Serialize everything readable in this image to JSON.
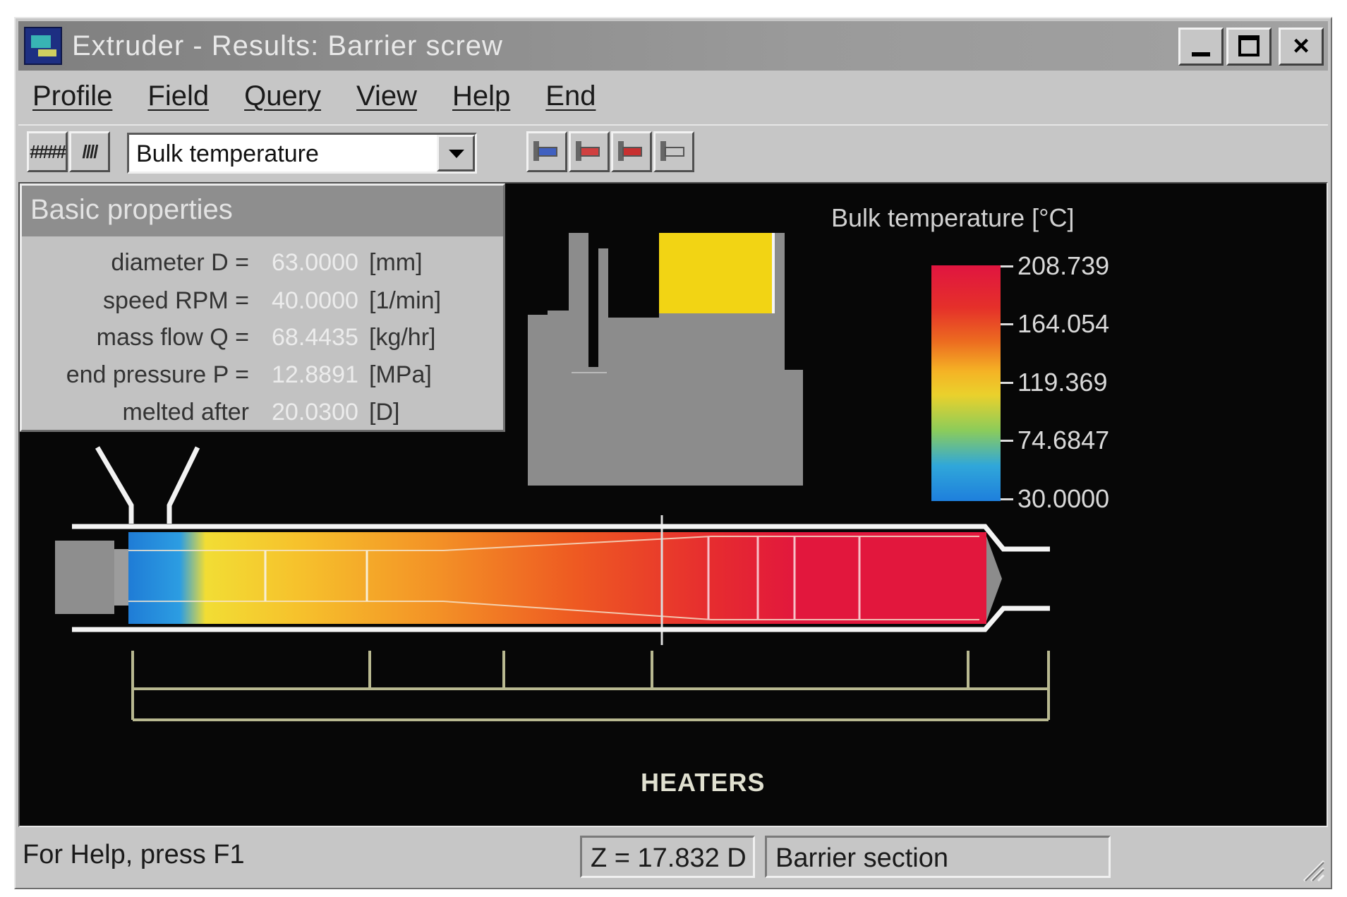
{
  "window": {
    "title": "Extruder - Results: Barrier screw",
    "controls": {
      "minimize": "_",
      "maximize": "□",
      "close": "×"
    }
  },
  "menu": [
    {
      "label": "Profile"
    },
    {
      "label": "Field"
    },
    {
      "label": "Query"
    },
    {
      "label": "View"
    },
    {
      "label": "Help"
    },
    {
      "label": "End"
    }
  ],
  "toolbar": {
    "grid_buttons": [
      {
        "icon": "grid-icon",
        "glyph": "####"
      },
      {
        "icon": "grid-skew-icon",
        "glyph": "////"
      }
    ],
    "field_select": {
      "value": "Bulk temperature"
    },
    "tool_buttons": [
      {
        "icon": "screw-section-icon"
      },
      {
        "icon": "screw-profile-icon"
      },
      {
        "icon": "screw-fill-icon"
      },
      {
        "icon": "screw-arrow-icon"
      }
    ]
  },
  "properties": {
    "title": "Basic properties",
    "rows": [
      {
        "label": "diameter  D =",
        "value": "63.0000",
        "unit": "[mm]"
      },
      {
        "label": "speed  RPM =",
        "value": "40.0000",
        "unit": "[1/min]"
      },
      {
        "label": "mass flow  Q =",
        "value": "68.4435",
        "unit": "[kg/hr]"
      },
      {
        "label": "end pressure P =",
        "value": "12.8891",
        "unit": "[MPa]"
      },
      {
        "label": "melted after",
        "value": "20.0300",
        "unit": "[D]"
      }
    ]
  },
  "legend": {
    "title": "Bulk temperature   [°C]",
    "ticks": [
      "208.739",
      "164.054",
      "119.369",
      "74.6847",
      "30.0000"
    ],
    "colors": {
      "max": "#e01540",
      "high": "#ec6a20",
      "mid": "#ead12c",
      "low": "#30a7da",
      "min": "#1e7fdc"
    }
  },
  "extruder": {
    "heaters_label": "HEATERS"
  },
  "statusbar": {
    "help": "For Help, press F1",
    "position": "Z =   17.832 D",
    "section": "Barrier section"
  }
}
